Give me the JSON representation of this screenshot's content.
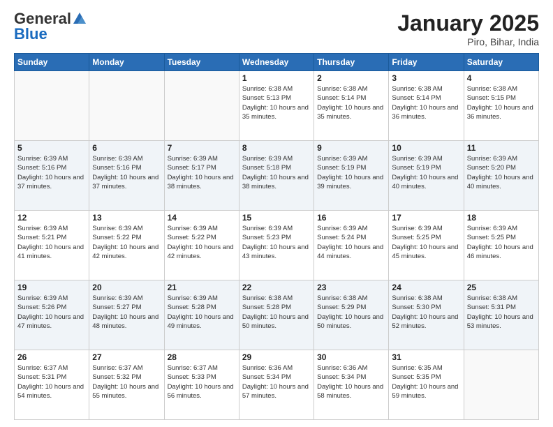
{
  "header": {
    "logo_general": "General",
    "logo_blue": "Blue",
    "title": "January 2025",
    "location": "Piro, Bihar, India"
  },
  "weekdays": [
    "Sunday",
    "Monday",
    "Tuesday",
    "Wednesday",
    "Thursday",
    "Friday",
    "Saturday"
  ],
  "weeks": [
    [
      {
        "day": "",
        "info": ""
      },
      {
        "day": "",
        "info": ""
      },
      {
        "day": "",
        "info": ""
      },
      {
        "day": "1",
        "info": "Sunrise: 6:38 AM\nSunset: 5:13 PM\nDaylight: 10 hours\nand 35 minutes."
      },
      {
        "day": "2",
        "info": "Sunrise: 6:38 AM\nSunset: 5:14 PM\nDaylight: 10 hours\nand 35 minutes."
      },
      {
        "day": "3",
        "info": "Sunrise: 6:38 AM\nSunset: 5:14 PM\nDaylight: 10 hours\nand 36 minutes."
      },
      {
        "day": "4",
        "info": "Sunrise: 6:38 AM\nSunset: 5:15 PM\nDaylight: 10 hours\nand 36 minutes."
      }
    ],
    [
      {
        "day": "5",
        "info": "Sunrise: 6:39 AM\nSunset: 5:16 PM\nDaylight: 10 hours\nand 37 minutes."
      },
      {
        "day": "6",
        "info": "Sunrise: 6:39 AM\nSunset: 5:16 PM\nDaylight: 10 hours\nand 37 minutes."
      },
      {
        "day": "7",
        "info": "Sunrise: 6:39 AM\nSunset: 5:17 PM\nDaylight: 10 hours\nand 38 minutes."
      },
      {
        "day": "8",
        "info": "Sunrise: 6:39 AM\nSunset: 5:18 PM\nDaylight: 10 hours\nand 38 minutes."
      },
      {
        "day": "9",
        "info": "Sunrise: 6:39 AM\nSunset: 5:19 PM\nDaylight: 10 hours\nand 39 minutes."
      },
      {
        "day": "10",
        "info": "Sunrise: 6:39 AM\nSunset: 5:19 PM\nDaylight: 10 hours\nand 40 minutes."
      },
      {
        "day": "11",
        "info": "Sunrise: 6:39 AM\nSunset: 5:20 PM\nDaylight: 10 hours\nand 40 minutes."
      }
    ],
    [
      {
        "day": "12",
        "info": "Sunrise: 6:39 AM\nSunset: 5:21 PM\nDaylight: 10 hours\nand 41 minutes."
      },
      {
        "day": "13",
        "info": "Sunrise: 6:39 AM\nSunset: 5:22 PM\nDaylight: 10 hours\nand 42 minutes."
      },
      {
        "day": "14",
        "info": "Sunrise: 6:39 AM\nSunset: 5:22 PM\nDaylight: 10 hours\nand 42 minutes."
      },
      {
        "day": "15",
        "info": "Sunrise: 6:39 AM\nSunset: 5:23 PM\nDaylight: 10 hours\nand 43 minutes."
      },
      {
        "day": "16",
        "info": "Sunrise: 6:39 AM\nSunset: 5:24 PM\nDaylight: 10 hours\nand 44 minutes."
      },
      {
        "day": "17",
        "info": "Sunrise: 6:39 AM\nSunset: 5:25 PM\nDaylight: 10 hours\nand 45 minutes."
      },
      {
        "day": "18",
        "info": "Sunrise: 6:39 AM\nSunset: 5:25 PM\nDaylight: 10 hours\nand 46 minutes."
      }
    ],
    [
      {
        "day": "19",
        "info": "Sunrise: 6:39 AM\nSunset: 5:26 PM\nDaylight: 10 hours\nand 47 minutes."
      },
      {
        "day": "20",
        "info": "Sunrise: 6:39 AM\nSunset: 5:27 PM\nDaylight: 10 hours\nand 48 minutes."
      },
      {
        "day": "21",
        "info": "Sunrise: 6:39 AM\nSunset: 5:28 PM\nDaylight: 10 hours\nand 49 minutes."
      },
      {
        "day": "22",
        "info": "Sunrise: 6:38 AM\nSunset: 5:28 PM\nDaylight: 10 hours\nand 50 minutes."
      },
      {
        "day": "23",
        "info": "Sunrise: 6:38 AM\nSunset: 5:29 PM\nDaylight: 10 hours\nand 50 minutes."
      },
      {
        "day": "24",
        "info": "Sunrise: 6:38 AM\nSunset: 5:30 PM\nDaylight: 10 hours\nand 52 minutes."
      },
      {
        "day": "25",
        "info": "Sunrise: 6:38 AM\nSunset: 5:31 PM\nDaylight: 10 hours\nand 53 minutes."
      }
    ],
    [
      {
        "day": "26",
        "info": "Sunrise: 6:37 AM\nSunset: 5:31 PM\nDaylight: 10 hours\nand 54 minutes."
      },
      {
        "day": "27",
        "info": "Sunrise: 6:37 AM\nSunset: 5:32 PM\nDaylight: 10 hours\nand 55 minutes."
      },
      {
        "day": "28",
        "info": "Sunrise: 6:37 AM\nSunset: 5:33 PM\nDaylight: 10 hours\nand 56 minutes."
      },
      {
        "day": "29",
        "info": "Sunrise: 6:36 AM\nSunset: 5:34 PM\nDaylight: 10 hours\nand 57 minutes."
      },
      {
        "day": "30",
        "info": "Sunrise: 6:36 AM\nSunset: 5:34 PM\nDaylight: 10 hours\nand 58 minutes."
      },
      {
        "day": "31",
        "info": "Sunrise: 6:35 AM\nSunset: 5:35 PM\nDaylight: 10 hours\nand 59 minutes."
      },
      {
        "day": "",
        "info": ""
      }
    ]
  ]
}
